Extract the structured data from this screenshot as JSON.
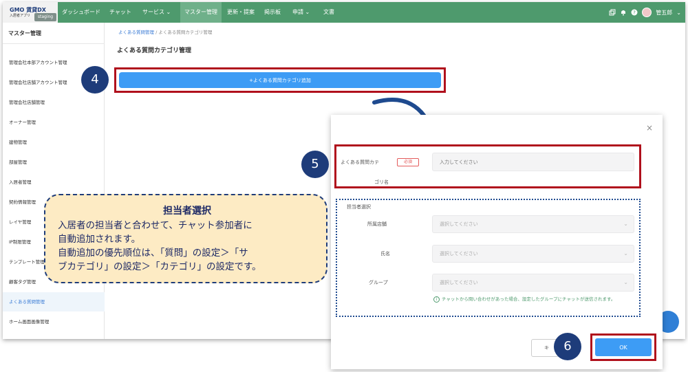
{
  "header": {
    "logo_brand": "GMO",
    "logo_product": "賃貸DX",
    "logo_sub": "入居者アプリ",
    "env_badge": "staging",
    "nav": [
      "ダッシュボード",
      "チャット",
      "サービス",
      "マスター管理",
      "更新・提案",
      "掲示板",
      "申請",
      "文書"
    ],
    "active_nav": "マスター管理",
    "user_name": "管五郎"
  },
  "sidebar": {
    "title": "マスター管理",
    "items": [
      "管理会社本部アカウント管理",
      "管理会社店舗アカウント管理",
      "管理会社店舗管理",
      "オーナー管理",
      "建物管理",
      "部屋管理",
      "入居者管理",
      "契約情報管理",
      "レイヤ管理",
      "IP制限管理",
      "テンプレート管理",
      "顧客タグ管理",
      "よくある質問管理",
      "ホーム画面画像管理"
    ],
    "active_item": "よくある質問管理"
  },
  "main": {
    "breadcrumb_link": "よくある質問管理",
    "breadcrumb_sep": "/",
    "breadcrumb_current": "よくある質問カテゴリ管理",
    "title": "よくある質問カテゴリ管理",
    "add_button": "+よくある質問カテゴリ追加"
  },
  "modal": {
    "close": "×",
    "category_label_1": "よくある質問カテ",
    "category_label_2": "ゴリ名",
    "required_badge": "必須",
    "category_placeholder": "入力してください",
    "assign_title": "担当者選択",
    "fields": [
      {
        "label": "所属店舗",
        "placeholder": "選択してください"
      },
      {
        "label": "氏名",
        "placeholder": "選択してください"
      },
      {
        "label": "グループ",
        "placeholder": "選択してください"
      }
    ],
    "hint_icon": "i",
    "hint": "チャットから問い合わせがあった場合、設定したグループにチャットが送信されます。",
    "cancel": "キ",
    "ok": "OK"
  },
  "steps": [
    "4",
    "5",
    "6"
  ],
  "callout": {
    "title": "担当者選択",
    "lines": [
      "入居者の担当者と合わせて、チャット参加者に",
      "自動追加されます。",
      "自動追加の優先順位は、「質問」の設定＞「サ",
      "ブカテゴリ」の設定＞「カテゴリ」の設定です。"
    ]
  },
  "colors": {
    "nav_green": "#4e9a6d",
    "primary_blue": "#3d9cf5",
    "highlight_red": "#b0101c",
    "step_navy": "#1e3c7a",
    "callout_bg": "#fdebc4"
  },
  "icons": [
    "copy-icon",
    "bell-icon",
    "help-icon",
    "chevron-down-icon",
    "close-icon",
    "info-icon",
    "chat-icon"
  ]
}
